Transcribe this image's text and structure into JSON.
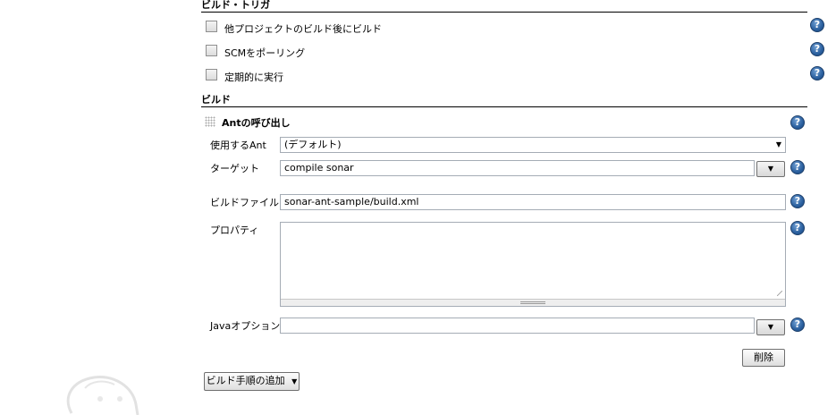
{
  "build_triggers": {
    "header": "ビルド・トリガ",
    "options": [
      {
        "label": "他プロジェクトのビルド後にビルド"
      },
      {
        "label": "SCMをポーリング"
      },
      {
        "label": "定期的に実行"
      }
    ]
  },
  "build": {
    "header": "ビルド",
    "step_title": "Antの呼び出し",
    "ant_label": "使用するAnt",
    "ant_value": "(デフォルト)",
    "targets_label": "ターゲット",
    "targets_value": "compile sonar",
    "build_file_label": "ビルドファイル",
    "build_file_value": "sonar-ant-sample/build.xml",
    "properties_label": "プロパティ",
    "properties_value": "",
    "java_opts_label": "Javaオプション",
    "java_opts_value": "",
    "delete_label": "削除",
    "add_step_label": "ビルド手順の追加"
  },
  "icons": {
    "help": "help-icon",
    "dropdown": "triangle-down-icon",
    "drag": "drag-handle-icon"
  },
  "help_glyph": "?",
  "arrow_glyph": "▼",
  "colors": {
    "help_icon": "#2a5f9e",
    "border": "#a5acb5"
  }
}
